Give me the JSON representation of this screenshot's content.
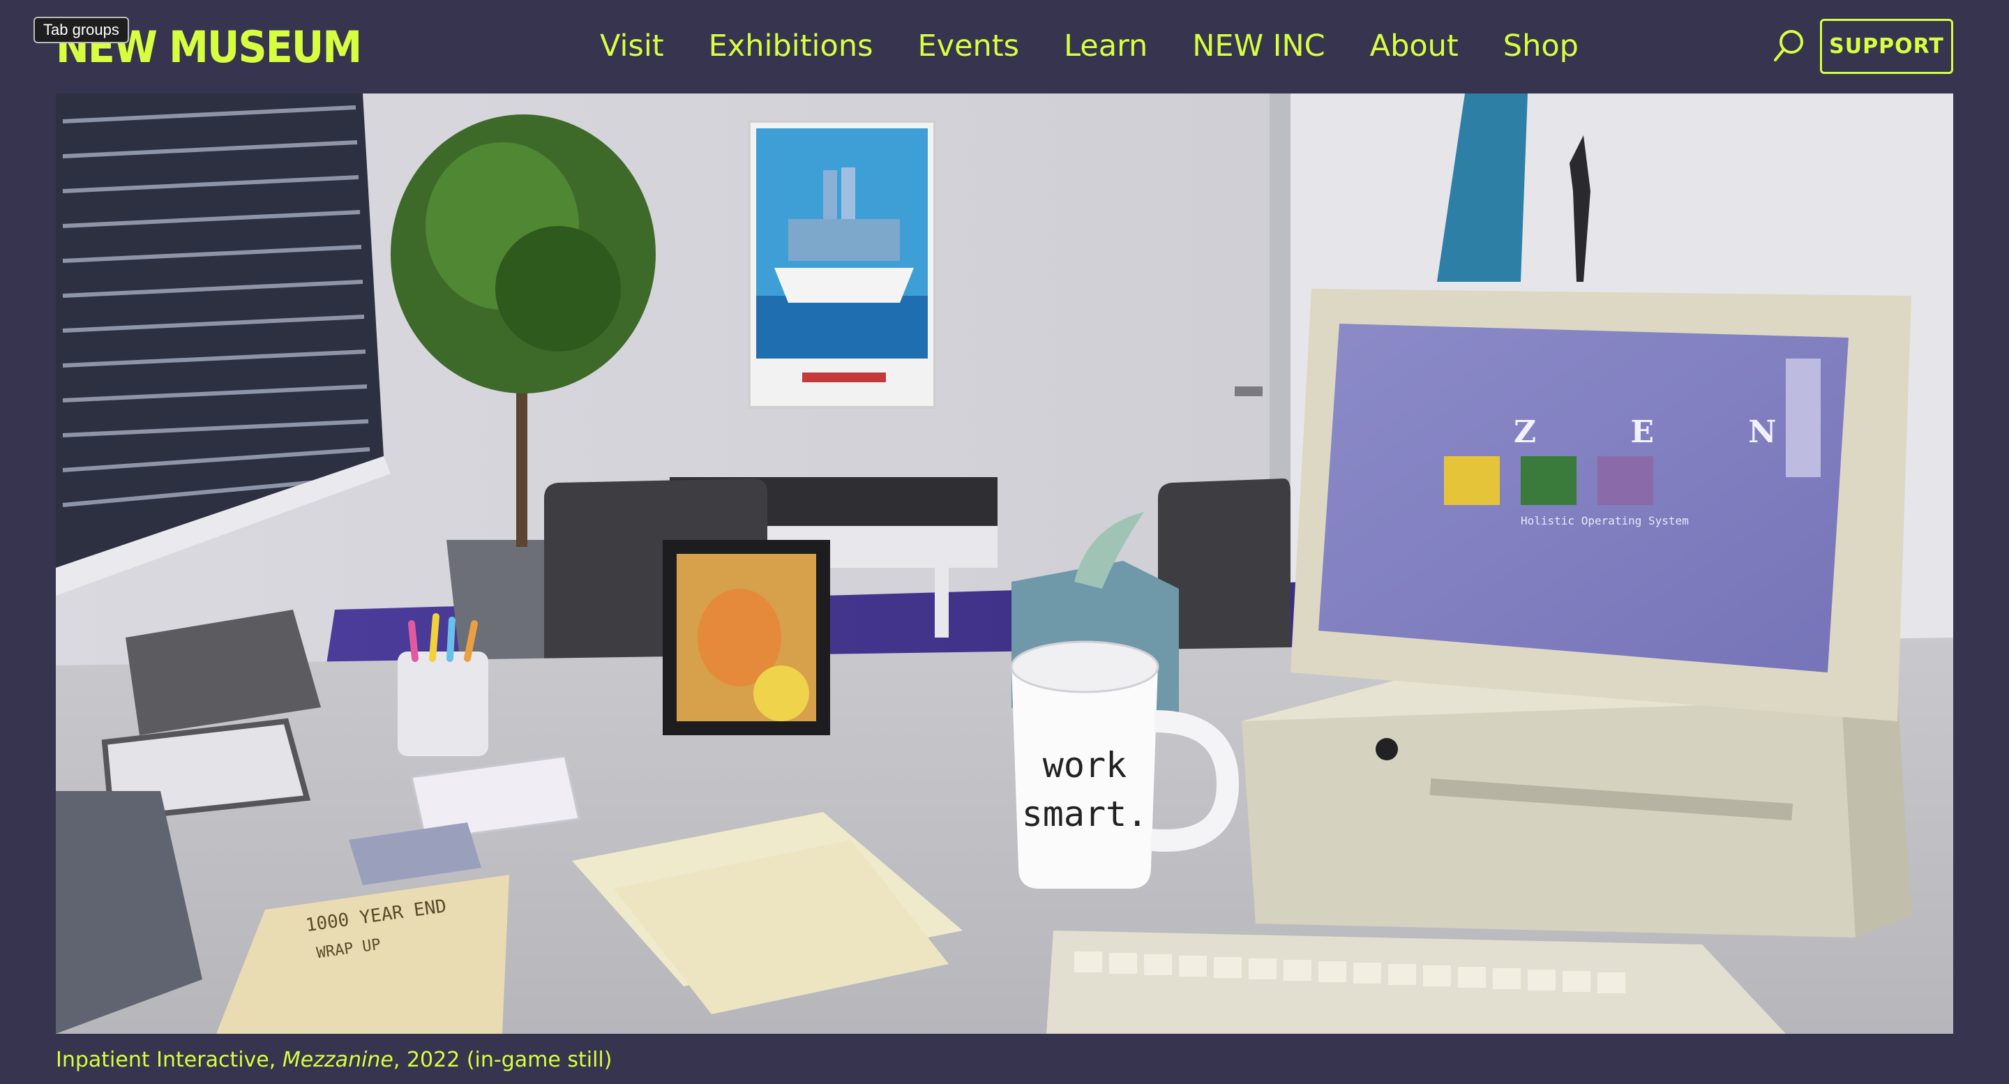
{
  "header": {
    "logo": "NEW MUSEUM",
    "tooltip": "Tab groups",
    "nav": [
      "Visit",
      "Exhibitions",
      "Events",
      "Learn",
      "NEW INC",
      "About",
      "Shop"
    ],
    "support_label": "SUPPORT",
    "search_icon": "search-icon"
  },
  "hero": {
    "mug_text_line1": "work",
    "mug_text_line2": "smart.",
    "screen_title": "Z E N",
    "screen_subtitle": "Holistic Operating System",
    "note_title": "1000 YEAR END",
    "note_line2": "WRAP UP"
  },
  "caption": {
    "artist": "Inpatient Interactive,",
    "title": "Mezzanine",
    "rest": ", 2022 (in-game still)"
  },
  "colors": {
    "background": "#36344f",
    "accent": "#d7ff3f"
  }
}
